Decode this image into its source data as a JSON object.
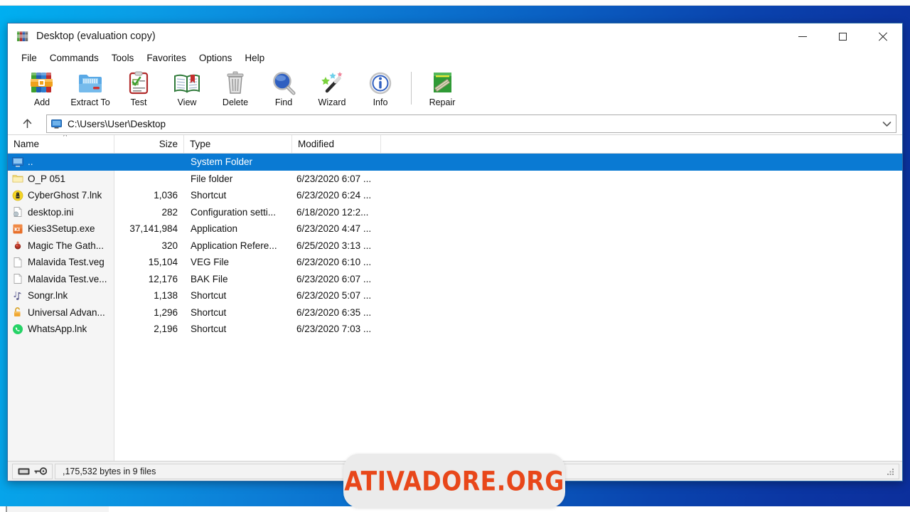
{
  "window": {
    "title": "Desktop (evaluation copy)",
    "app_icon": "winrar-books-icon",
    "controls": {
      "minimize": "minimize-icon",
      "maximize": "maximize-icon",
      "close": "close-icon"
    }
  },
  "menu": {
    "items": [
      {
        "label": "File"
      },
      {
        "label": "Commands"
      },
      {
        "label": "Tools"
      },
      {
        "label": "Favorites"
      },
      {
        "label": "Options"
      },
      {
        "label": "Help"
      }
    ]
  },
  "toolbar": {
    "buttons": [
      {
        "label": "Add",
        "icon": "add-archive-icon"
      },
      {
        "label": "Extract To",
        "icon": "extract-folder-icon"
      },
      {
        "label": "Test",
        "icon": "test-clipboard-icon"
      },
      {
        "label": "View",
        "icon": "view-book-icon"
      },
      {
        "label": "Delete",
        "icon": "delete-trash-icon"
      },
      {
        "label": "Find",
        "icon": "find-magnifier-icon"
      },
      {
        "label": "Wizard",
        "icon": "wizard-wand-icon"
      },
      {
        "label": "Info",
        "icon": "info-circle-icon"
      }
    ],
    "extra_buttons": [
      {
        "label": "Repair",
        "icon": "repair-icon"
      }
    ]
  },
  "address": {
    "up_icon": "up-arrow-icon",
    "path_icon": "desktop-monitor-icon",
    "path": "C:\\Users\\User\\Desktop",
    "dropdown_icon": "chevron-down-icon"
  },
  "columns": [
    {
      "key": "name",
      "label": "Name"
    },
    {
      "key": "size",
      "label": "Size"
    },
    {
      "key": "type",
      "label": "Type"
    },
    {
      "key": "modified",
      "label": "Modified"
    }
  ],
  "sort": {
    "column": "Name",
    "indicator": "^"
  },
  "files": [
    {
      "name": "..",
      "icon": "parent-folder-icon",
      "size": "",
      "type": "System Folder",
      "modified": "",
      "selected": true
    },
    {
      "name": "O_P 051",
      "icon": "folder-icon",
      "size": "",
      "type": "File folder",
      "modified": "6/23/2020 6:07 ...",
      "selected": false
    },
    {
      "name": "CyberGhost 7.lnk",
      "icon": "cyberghost-icon",
      "size": "1,036",
      "type": "Shortcut",
      "modified": "6/23/2020 6:24 ...",
      "selected": false
    },
    {
      "name": "desktop.ini",
      "icon": "ini-config-icon",
      "size": "282",
      "type": "Configuration setti...",
      "modified": "6/18/2020 12:2...",
      "selected": false
    },
    {
      "name": "Kies3Setup.exe",
      "icon": "kies-app-icon",
      "size": "37,141,984",
      "type": "Application",
      "modified": "6/23/2020 4:47 ...",
      "selected": false
    },
    {
      "name": "Magic The Gath...",
      "icon": "magic-gathering-icon",
      "size": "320",
      "type": "Application Refere...",
      "modified": "6/25/2020 3:13 ...",
      "selected": false
    },
    {
      "name": "Malavida Test.veg",
      "icon": "blank-file-icon",
      "size": "15,104",
      "type": "VEG File",
      "modified": "6/23/2020 6:10 ...",
      "selected": false
    },
    {
      "name": "Malavida Test.ve...",
      "icon": "blank-file-icon",
      "size": "12,176",
      "type": "BAK File",
      "modified": "6/23/2020 6:07 ...",
      "selected": false
    },
    {
      "name": "Songr.lnk",
      "icon": "music-note-icon",
      "size": "1,138",
      "type": "Shortcut",
      "modified": "6/23/2020 5:07 ...",
      "selected": false
    },
    {
      "name": "Universal Advan...",
      "icon": "unlock-padlock-icon",
      "size": "1,296",
      "type": "Shortcut",
      "modified": "6/23/2020 6:35 ...",
      "selected": false
    },
    {
      "name": "WhatsApp.lnk",
      "icon": "whatsapp-icon",
      "size": "2,196",
      "type": "Shortcut",
      "modified": "6/23/2020 7:03 ...",
      "selected": false
    }
  ],
  "status_bar": {
    "drive_icon": "drive-icon",
    "key_icon": "key-icon",
    "text": ",175,532 bytes in 9 files",
    "grip_icon": "resize-grip-icon"
  },
  "watermark": {
    "text": "ATIVADORE.ORG",
    "color": "#e8471a",
    "background": "#ebebeb"
  },
  "theme": {
    "selection_blue": "#0a7ad3",
    "desktop_blue_light": "#00aff0",
    "desktop_blue_dark": "#0c2f9c",
    "window_border": "#2f6ea8"
  }
}
